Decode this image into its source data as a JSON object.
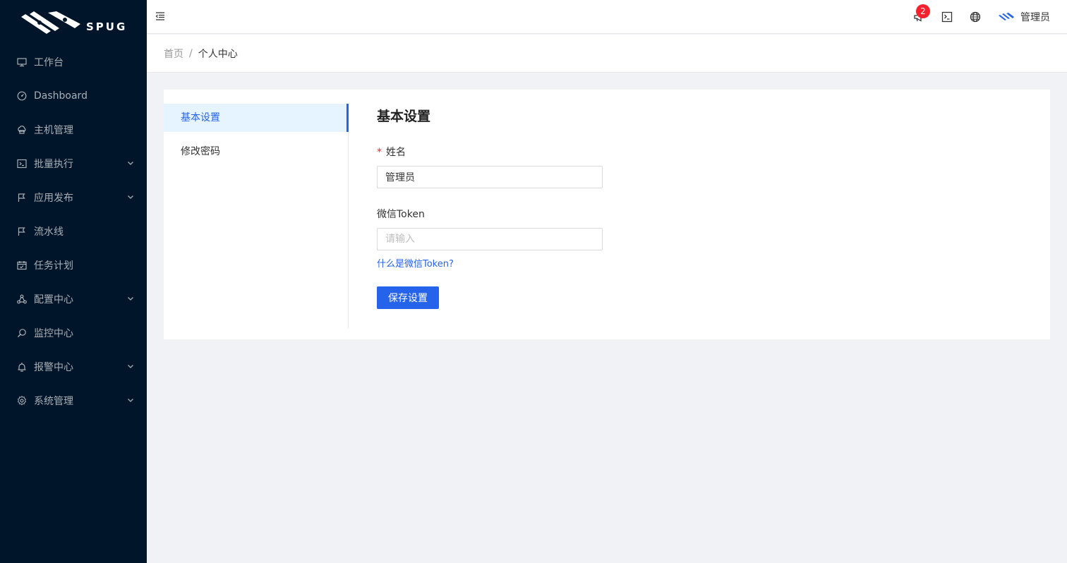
{
  "logo": {
    "text": "SPUG",
    "icon": "spug-logo"
  },
  "sidebar": {
    "items": [
      {
        "label": "工作台",
        "icon": "desktop-icon",
        "has_arrow": false
      },
      {
        "label": "Dashboard",
        "icon": "dashboard-icon",
        "has_arrow": false
      },
      {
        "label": "主机管理",
        "icon": "cloud-server-icon",
        "has_arrow": false
      },
      {
        "label": "批量执行",
        "icon": "terminal-icon",
        "has_arrow": true
      },
      {
        "label": "应用发布",
        "icon": "flag-icon",
        "has_arrow": true
      },
      {
        "label": "流水线",
        "icon": "flag-icon",
        "has_arrow": false
      },
      {
        "label": "任务计划",
        "icon": "schedule-icon",
        "has_arrow": false
      },
      {
        "label": "配置中心",
        "icon": "deployment-unit-icon",
        "has_arrow": true
      },
      {
        "label": "监控中心",
        "icon": "monitor-search-icon",
        "has_arrow": false
      },
      {
        "label": "报警中心",
        "icon": "alert-icon",
        "has_arrow": true
      },
      {
        "label": "系统管理",
        "icon": "setting-icon",
        "has_arrow": true
      }
    ]
  },
  "header": {
    "notification_count": "2",
    "user_name": "管理员"
  },
  "breadcrumb": {
    "home": "首页",
    "separator": "/",
    "current": "个人中心"
  },
  "settings_menu": {
    "items": [
      {
        "label": "基本设置",
        "active": true
      },
      {
        "label": "修改密码",
        "active": false
      }
    ]
  },
  "form": {
    "title": "基本设置",
    "name_label": "姓名",
    "name_required_mark": "*",
    "name_value": "管理员",
    "token_label": "微信Token",
    "token_placeholder": "请输入",
    "token_help": "什么是微信Token?",
    "save_label": "保存设置"
  },
  "colors": {
    "sidebar_bg": "#001529",
    "primary": "#2563eb",
    "badge": "#f5222d",
    "page_bg": "#f0f2f5"
  }
}
